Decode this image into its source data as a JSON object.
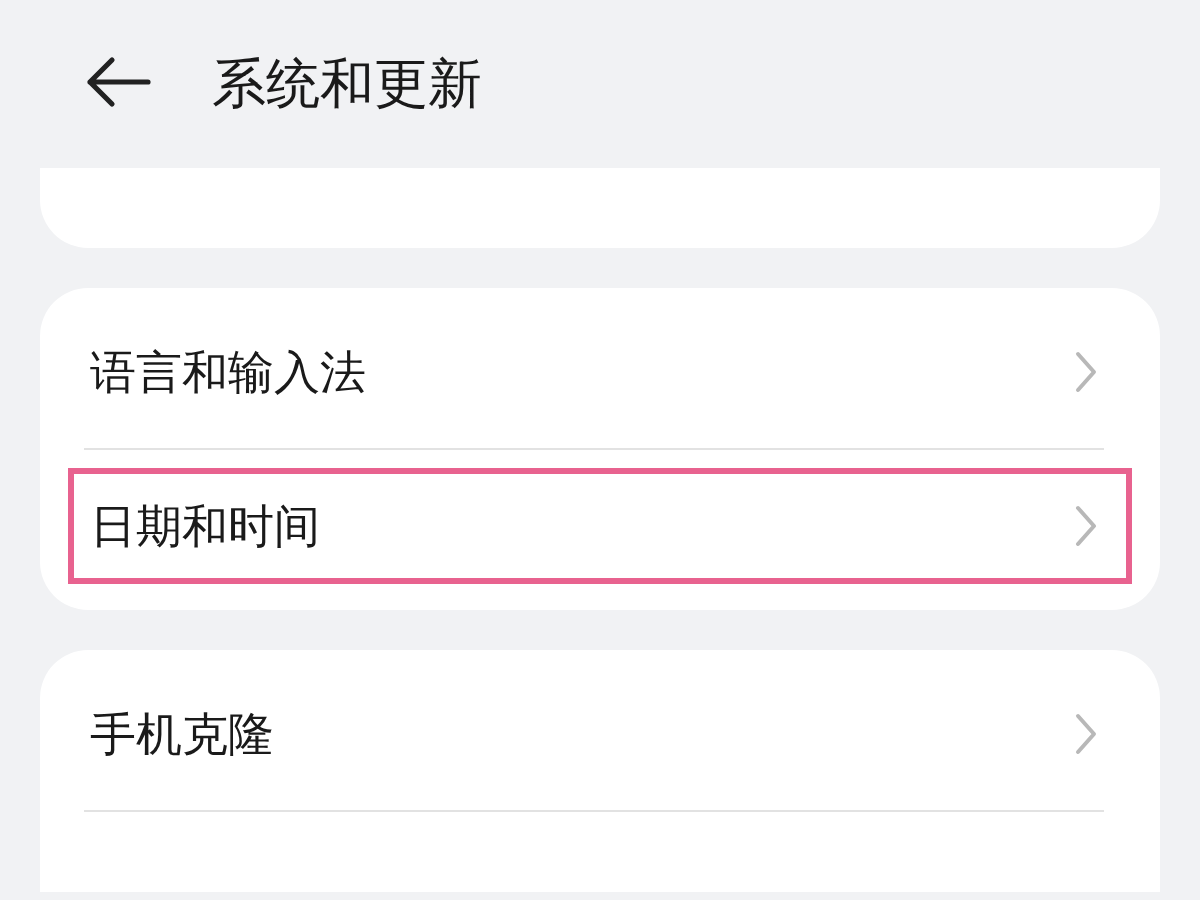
{
  "header": {
    "title": "系统和更新"
  },
  "groups": [
    {
      "cut_off": false,
      "items": [
        {
          "label": "语言和输入法",
          "highlighted": false
        },
        {
          "label": "日期和时间",
          "highlighted": true
        }
      ]
    },
    {
      "cut_off": true,
      "items": [
        {
          "label": "手机克隆",
          "highlighted": false
        }
      ]
    }
  ]
}
